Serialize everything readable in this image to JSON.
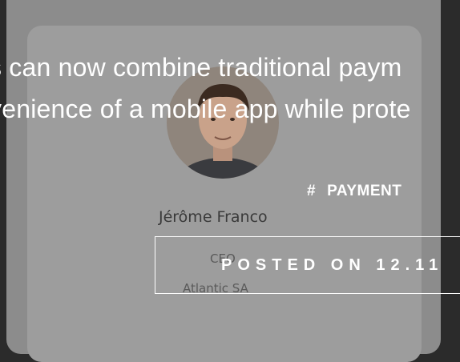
{
  "article": {
    "text_line1": "s can now combine traditional paym",
    "text_line2": "venience of a mobile app while prote",
    "tag_symbol": "#",
    "tag": "PAYMENT",
    "posted_label": "POSTED ON 12.11"
  },
  "testimonial": {
    "person_name": "Jérôme Franco",
    "role": "CEO",
    "company": "Atlantic SA"
  }
}
